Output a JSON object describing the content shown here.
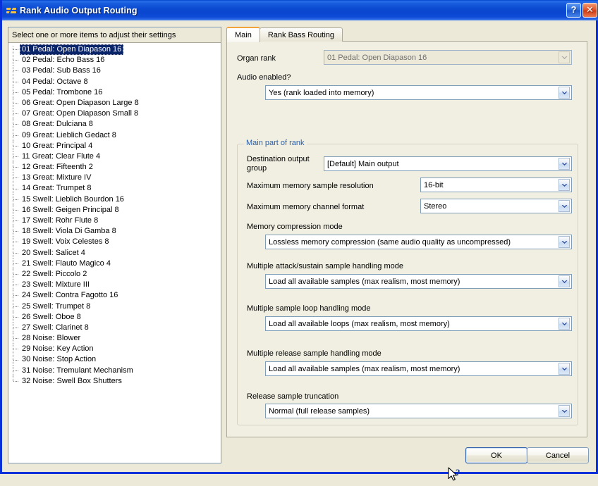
{
  "window": {
    "title": "Rank Audio Output Routing",
    "icon": "rank-routing-icon",
    "help_button": "?",
    "close_button": "✕",
    "titlebar_color": "#0b4ed4"
  },
  "left_panel": {
    "header": "Select one or more items to adjust their settings",
    "selection_color": "#0a246a",
    "items": [
      {
        "label": "01 Pedal: Open Diapason 16",
        "selected": true
      },
      {
        "label": "02 Pedal: Echo Bass 16",
        "selected": false
      },
      {
        "label": "03 Pedal: Sub Bass 16",
        "selected": false
      },
      {
        "label": "04 Pedal: Octave 8",
        "selected": false
      },
      {
        "label": "05 Pedal: Trombone 16",
        "selected": false
      },
      {
        "label": "06 Great: Open Diapason Large 8",
        "selected": false
      },
      {
        "label": "07 Great: Open Diapason Small 8",
        "selected": false
      },
      {
        "label": "08 Great: Dulciana 8",
        "selected": false
      },
      {
        "label": "09 Great: Lieblich Gedact 8",
        "selected": false
      },
      {
        "label": "10 Great: Principal 4",
        "selected": false
      },
      {
        "label": "11 Great: Clear Flute 4",
        "selected": false
      },
      {
        "label": "12 Great: Fifteenth 2",
        "selected": false
      },
      {
        "label": "13 Great: Mixture IV",
        "selected": false
      },
      {
        "label": "14 Great: Trumpet 8",
        "selected": false
      },
      {
        "label": "15 Swell: Lieblich Bourdon 16",
        "selected": false
      },
      {
        "label": "16 Swell: Geigen Principal 8",
        "selected": false
      },
      {
        "label": "17 Swell: Rohr Flute 8",
        "selected": false
      },
      {
        "label": "18 Swell: Viola Di Gamba 8",
        "selected": false
      },
      {
        "label": "19 Swell: Voix Celestes 8",
        "selected": false
      },
      {
        "label": "20 Swell: Salicet 4",
        "selected": false
      },
      {
        "label": "21 Swell: Flauto Magico 4",
        "selected": false
      },
      {
        "label": "22 Swell: Piccolo 2",
        "selected": false
      },
      {
        "label": "23 Swell: Mixture III",
        "selected": false
      },
      {
        "label": "24 Swell: Contra Fagotto 16",
        "selected": false
      },
      {
        "label": "25 Swell: Trumpet 8",
        "selected": false
      },
      {
        "label": "26 Swell: Oboe 8",
        "selected": false
      },
      {
        "label": "27 Swell: Clarinet 8",
        "selected": false
      },
      {
        "label": "28 Noise: Blower",
        "selected": false
      },
      {
        "label": "29 Noise: Key Action",
        "selected": false
      },
      {
        "label": "30 Noise: Stop Action",
        "selected": false
      },
      {
        "label": "31 Noise: Tremulant Mechanism",
        "selected": false
      },
      {
        "label": "32 Noise: Swell Box Shutters",
        "selected": false
      }
    ]
  },
  "tabs": [
    {
      "label": "Main",
      "active": true
    },
    {
      "label": "Rank Bass Routing",
      "active": false
    }
  ],
  "main_tab": {
    "organ_rank": {
      "label": "Organ rank",
      "value": "01 Pedal: Open Diapason 16",
      "disabled": true
    },
    "audio_enabled": {
      "label": "Audio enabled?",
      "value": "Yes (rank loaded into memory)"
    },
    "group": {
      "title": "Main part of rank",
      "title_color": "#2b5faa",
      "fields": [
        {
          "label": "Destination output\ngroup",
          "value": "[Default] Main output"
        },
        {
          "label": "Maximum memory sample resolution",
          "value": "16-bit"
        },
        {
          "label": "Maximum memory channel format",
          "value": "Stereo"
        },
        {
          "label": "Memory compression mode",
          "value": "Lossless memory compression (same audio quality as uncompressed)"
        },
        {
          "label": "Multiple attack/sustain sample handling mode",
          "value": "Load all available samples (max realism, most memory)"
        },
        {
          "label": "Multiple sample loop handling mode",
          "value": "Load all available loops (max realism, most memory)"
        },
        {
          "label": "Multiple release sample handling mode",
          "value": "Load all available samples (max realism, most memory)"
        },
        {
          "label": "Release sample truncation",
          "value": "Normal (full release samples)"
        }
      ]
    }
  },
  "footer": {
    "ok": "OK",
    "cancel": "Cancel",
    "cursor": "help-cursor"
  }
}
